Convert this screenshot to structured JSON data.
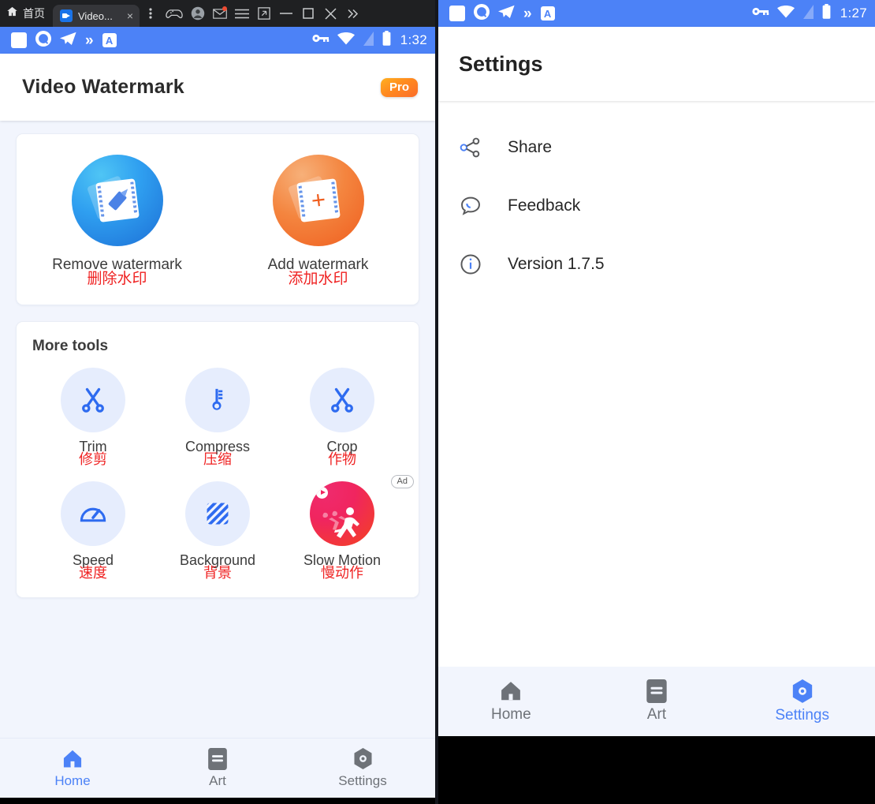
{
  "browser": {
    "home_label": "首页",
    "home_icon": "home-icon",
    "tab": {
      "title": "Video...",
      "favicon": "video-app-favicon",
      "close": "×"
    },
    "icons": [
      "tab-menu-dots-icon",
      "gamepad-icon",
      "account-avatar-icon",
      "mail-icon",
      "hamburger-menu-icon",
      "popout-window-icon",
      "minimize-icon",
      "maximize-icon",
      "close-icon",
      "overflow-chevrons-icon"
    ]
  },
  "statusbar_left": {
    "icons": [
      "white-square-icon",
      "q-app-icon",
      "telegram-icon",
      "double-chevron-icon",
      "translate-a-icon"
    ],
    "right_icons": [
      "vpn-key-icon",
      "wifi-icon",
      "sim-off-icon",
      "battery-icon"
    ],
    "clock": "1:32",
    "background": "#4c82f7"
  },
  "statusbar_right": {
    "icons": [
      "white-square-icon",
      "q-app-icon",
      "telegram-icon",
      "double-chevron-icon",
      "translate-a-icon"
    ],
    "right_icons": [
      "vpn-key-icon",
      "wifi-icon",
      "sim-off-icon",
      "battery-icon"
    ],
    "clock": "1:27",
    "background": "#4c82f7"
  },
  "left_app": {
    "title": "Video Watermark",
    "pro_badge": "Pro",
    "main_actions": [
      {
        "label": "Remove watermark",
        "label_cn": "删除水印",
        "icon": "remove-watermark-icon",
        "color": "#2f9ff0"
      },
      {
        "label": "Add watermark",
        "label_cn": "添加水印",
        "icon": "add-watermark-icon",
        "color": "#f4853f"
      }
    ],
    "more_tools_title": "More tools",
    "tools": [
      {
        "label": "Trim",
        "label_cn": "修剪",
        "icon": "scissors-icon",
        "ad": false
      },
      {
        "label": "Compress",
        "label_cn": "压缩",
        "icon": "compress-icon",
        "ad": false
      },
      {
        "label": "Crop",
        "label_cn": "作物",
        "icon": "scissors-icon",
        "ad": false
      },
      {
        "label": "Speed",
        "label_cn": "速度",
        "icon": "speedometer-icon",
        "ad": false
      },
      {
        "label": "Background",
        "label_cn": "背景",
        "icon": "hatched-square-icon",
        "ad": false
      },
      {
        "label": "Slow Motion",
        "label_cn": "慢动作",
        "icon": "running-person-ad-icon",
        "ad": true,
        "ad_label": "Ad"
      }
    ],
    "bottom_nav": [
      {
        "label": "Home",
        "icon": "home-icon",
        "active": true
      },
      {
        "label": "Art",
        "icon": "art-icon",
        "active": false
      },
      {
        "label": "Settings",
        "icon": "gear-hex-icon",
        "active": false
      }
    ]
  },
  "right_app": {
    "title": "Settings",
    "rows": [
      {
        "label": "Share",
        "icon": "share-icon"
      },
      {
        "label": "Feedback",
        "icon": "feedback-chat-icon"
      },
      {
        "label": "Version 1.7.5",
        "icon": "info-icon"
      }
    ],
    "bottom_nav": [
      {
        "label": "Home",
        "icon": "home-icon",
        "active": false
      },
      {
        "label": "Art",
        "icon": "art-icon",
        "active": false
      },
      {
        "label": "Settings",
        "icon": "gear-hex-icon",
        "active": true
      }
    ]
  },
  "colors": {
    "accent_blue": "#4c82f7",
    "page_bg": "#f2f5fd",
    "red_translation": "#ef2222",
    "nav_inactive": "#6e7278"
  }
}
